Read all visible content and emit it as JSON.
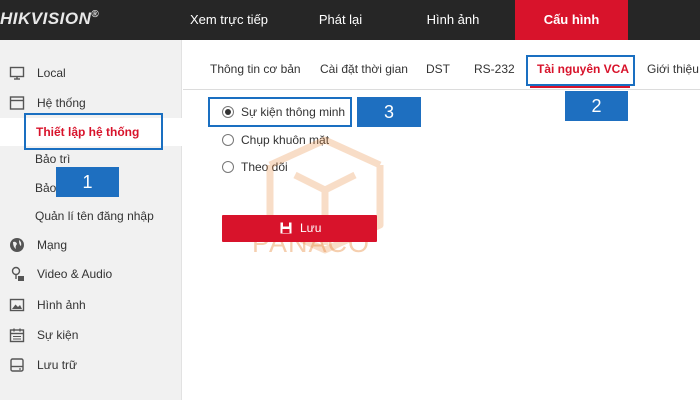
{
  "app": {
    "brand": "HIKVISION",
    "brand_mark": "®"
  },
  "topnav": {
    "items": [
      {
        "label": "Xem trực tiếp"
      },
      {
        "label": "Phát lại"
      },
      {
        "label": "Hình ảnh"
      },
      {
        "label": "Cấu hình",
        "active": true
      }
    ]
  },
  "sidebar": {
    "items": [
      {
        "label": "Local",
        "icon": "monitor-icon"
      },
      {
        "label": "Hệ thống",
        "icon": "system-icon"
      },
      {
        "label": "Thiết lập hệ thống",
        "selected": true
      },
      {
        "label": "Bảo trì"
      },
      {
        "label": "Bảo"
      },
      {
        "label": "Quản lí tên đăng nhập"
      },
      {
        "label": "Mạng",
        "icon": "globe-icon"
      },
      {
        "label": "Video & Audio",
        "icon": "video-audio-icon"
      },
      {
        "label": "Hình ảnh",
        "icon": "image-icon"
      },
      {
        "label": "Sự kiện",
        "icon": "calendar-icon"
      },
      {
        "label": "Lưu trữ",
        "icon": "storage-icon"
      }
    ]
  },
  "tabs": {
    "items": [
      {
        "label": "Thông tin cơ bản"
      },
      {
        "label": "Cài đặt thời gian"
      },
      {
        "label": "DST"
      },
      {
        "label": "RS-232"
      },
      {
        "label": "Tài nguyên VCA",
        "active": true
      },
      {
        "label": "Giới thiệu"
      }
    ]
  },
  "vca": {
    "options": [
      {
        "label": "Sự kiện thông minh",
        "checked": true
      },
      {
        "label": "Chụp khuôn mặt",
        "checked": false
      },
      {
        "label": "Theo dõi",
        "checked": false
      }
    ],
    "save_label": "Lưu"
  },
  "annotations": {
    "badges": [
      "1",
      "2",
      "3"
    ]
  },
  "watermark": {
    "text": "PANACO"
  },
  "colors": {
    "accent": "#d8132b",
    "topbar": "#262626",
    "annotation": "#1e6fc0",
    "watermark": "#e8883a"
  }
}
